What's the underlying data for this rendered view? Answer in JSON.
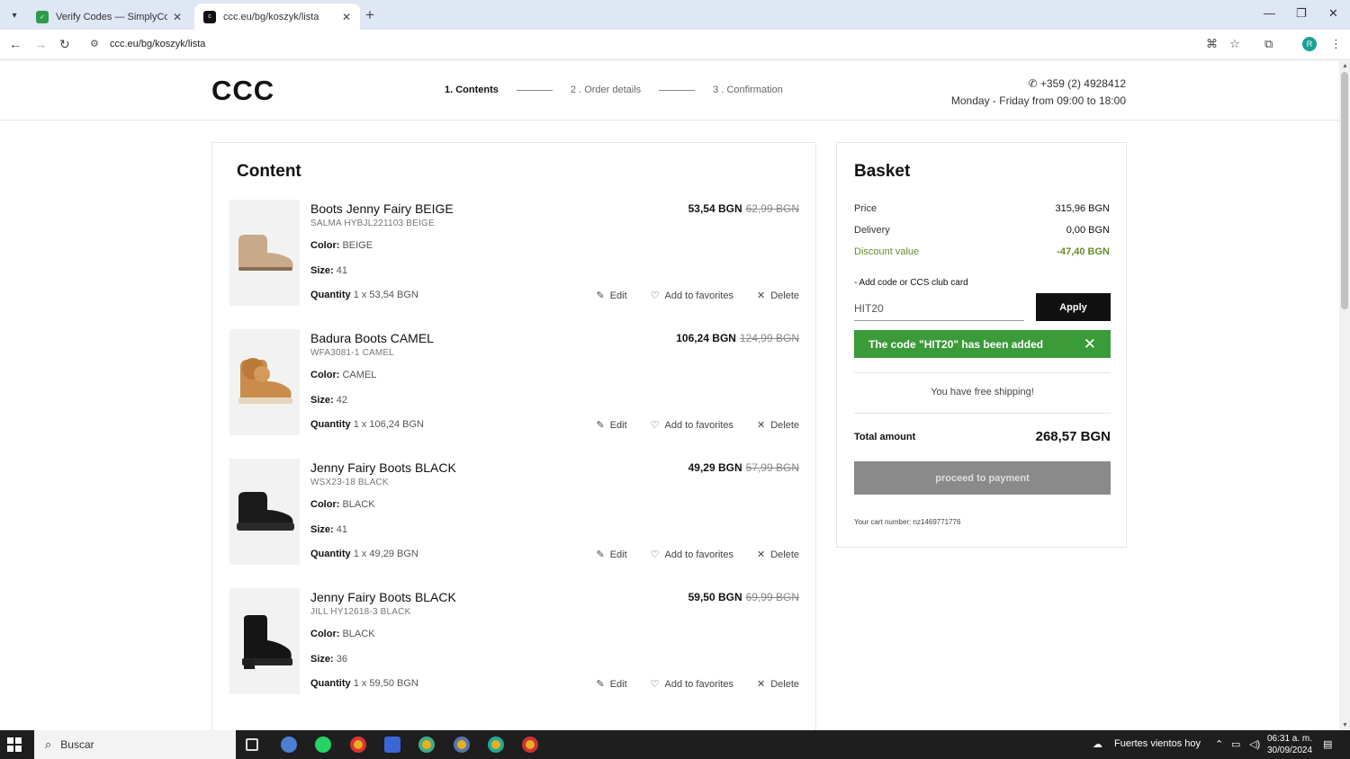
{
  "browser": {
    "tabs": [
      {
        "title": "Verify Codes — SimplyCodes",
        "active": false
      },
      {
        "title": "ccc.eu/bg/koszyk/lista",
        "active": true
      }
    ],
    "url": "ccc.eu/bg/koszyk/lista",
    "profile_initial": "R"
  },
  "header": {
    "logo": "CCC",
    "steps": [
      "1. Contents",
      "2 . Order details",
      "3 . Confirmation"
    ],
    "phone": "+359 (2) 4928412",
    "hours": "Monday - Friday from 09:00 to 18:00"
  },
  "content": {
    "title": "Content",
    "items": [
      {
        "name": "Boots Jenny Fairy BEIGE",
        "sku": "SALMA HYBJL221103 BEIGE",
        "color_label": "Color:",
        "color": "BEIGE",
        "size_label": "Size:",
        "size": "41",
        "qty_label": "Quantity",
        "qty": "1 x 53,54  BGN",
        "price": "53,54 BGN",
        "old_price": "62,99  BGN",
        "image": "beige-boot"
      },
      {
        "name": "Badura Boots CAMEL",
        "sku": "WFA3081-1 CAMEL",
        "color_label": "Color:",
        "color": "CAMEL",
        "size_label": "Size:",
        "size": "42",
        "qty_label": "Quantity",
        "qty": "1 x 106,24  BGN",
        "price": "106,24 BGN",
        "old_price": "124,99  BGN",
        "image": "camel-fur-boot"
      },
      {
        "name": "Jenny Fairy Boots BLACK",
        "sku": "WSX23-18 BLACK",
        "color_label": "Color:",
        "color": "BLACK",
        "size_label": "Size:",
        "size": "41",
        "qty_label": "Quantity",
        "qty": "1 x 49,29  BGN",
        "price": "49,29 BGN",
        "old_price": "57,99  BGN",
        "image": "black-boot"
      },
      {
        "name": "Jenny Fairy Boots BLACK",
        "sku": "JILL HY12618-3 BLACK",
        "color_label": "Color:",
        "color": "BLACK",
        "size_label": "Size:",
        "size": "36",
        "qty_label": "Quantity",
        "qty": "1 x 59,50  BGN",
        "price": "59,50 BGN",
        "old_price": "69,99  BGN",
        "image": "black-ankle-boot"
      }
    ],
    "actions": {
      "edit": "Edit",
      "favorite": "Add to favorites",
      "delete": "Delete"
    }
  },
  "basket": {
    "title": "Basket",
    "price_label": "Price",
    "price": "315,96 BGN",
    "delivery_label": "Delivery",
    "delivery": "0,00 BGN",
    "discount_label": "Discount value",
    "discount": "-47,40 BGN",
    "code_label": "- Add code or CCS club card",
    "code_value": "HIT20",
    "apply_label": "Apply",
    "notice": "The code \"HIT20\" has been added",
    "free_shipping": "You have free shipping!",
    "total_label": "Total amount",
    "total": "268,57 BGN",
    "pay_label": "proceed to payment",
    "cart_number": "Your cart number: nz1469771776"
  },
  "taskbar": {
    "search_placeholder": "Buscar",
    "weather": "Fuertes vientos hoy",
    "time": "06:31 a. m.",
    "date": "30/09/2024"
  },
  "colors": {
    "accent_green": "#3a9b38",
    "discount_green": "#6a8a2a",
    "button_black": "#111111"
  }
}
